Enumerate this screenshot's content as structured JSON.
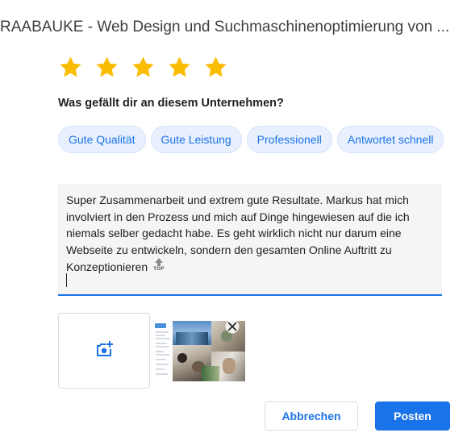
{
  "header": {
    "title": "RAABAUKE - Web Design und Suchmaschinenoptimierung von ..."
  },
  "rating": {
    "stars_selected": 5,
    "stars_total": 5,
    "star_color": "#fbbc04"
  },
  "question": {
    "label": "Was gefällt dir an diesem Unternehmen?"
  },
  "chips": [
    {
      "label": "Gute Qualität"
    },
    {
      "label": "Gute Leistung"
    },
    {
      "label": "Professionell"
    },
    {
      "label": "Antwortet schnell"
    }
  ],
  "review": {
    "text": "Super Zusammenarbeit und extrem gute Resultate. Markus hat mich involviert in den Prozess und mich auf Dinge hingewiesen auf die ich niemals selber gedacht habe. Es geht wirklich nicht nur darum eine Webseite zu entwickeln, sondern den gesamten Online Auftritt zu Konzeptionieren",
    "inline_icon": "scroll-to-top-icon",
    "inline_icon_label": "TOP"
  },
  "media": {
    "add_photo_icon": "add-photo-icon",
    "thumbnail_icon": "close-icon"
  },
  "actions": {
    "cancel_label": "Abbrechen",
    "post_label": "Posten"
  },
  "colors": {
    "accent": "#1a73e8",
    "chip_bg": "#e8f0fe",
    "input_bg": "#f5f5f5"
  }
}
